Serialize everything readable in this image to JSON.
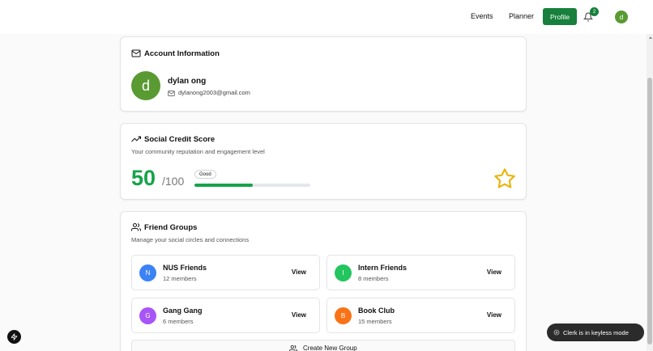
{
  "nav": {
    "events": "Events",
    "planner": "Planner",
    "profile": "Profile",
    "notification_count": "2",
    "avatar_initial": "d"
  },
  "account": {
    "title": "Account Information",
    "avatar_initial": "d",
    "name": "dylan ong",
    "email": "dylanong2003@gmail.com"
  },
  "social": {
    "title": "Social Credit Score",
    "subtitle": "Your community reputation and engagement level",
    "score": "50",
    "max": "/100",
    "badge": "Good",
    "progress_percent": 50
  },
  "friends": {
    "title": "Friend Groups",
    "subtitle": "Manage your social circles and connections",
    "groups": [
      {
        "initial": "N",
        "name": "NUS Friends",
        "members": "12 members",
        "view": "View",
        "color": "#3b82f6"
      },
      {
        "initial": "I",
        "name": "Intern Friends",
        "members": "8 members",
        "view": "View",
        "color": "#22c55e"
      },
      {
        "initial": "G",
        "name": "Gang Gang",
        "members": "6 members",
        "view": "View",
        "color": "#a855f7"
      },
      {
        "initial": "B",
        "name": "Book Club",
        "members": "15 members",
        "view": "View",
        "color": "#f97316"
      }
    ],
    "create_label": "Create New Group"
  },
  "clerk": {
    "text": "Clerk is in keyless mode"
  },
  "colors": {
    "accent_green": "#16803c",
    "score_green": "#16a34a",
    "star_yellow": "#eab308"
  }
}
